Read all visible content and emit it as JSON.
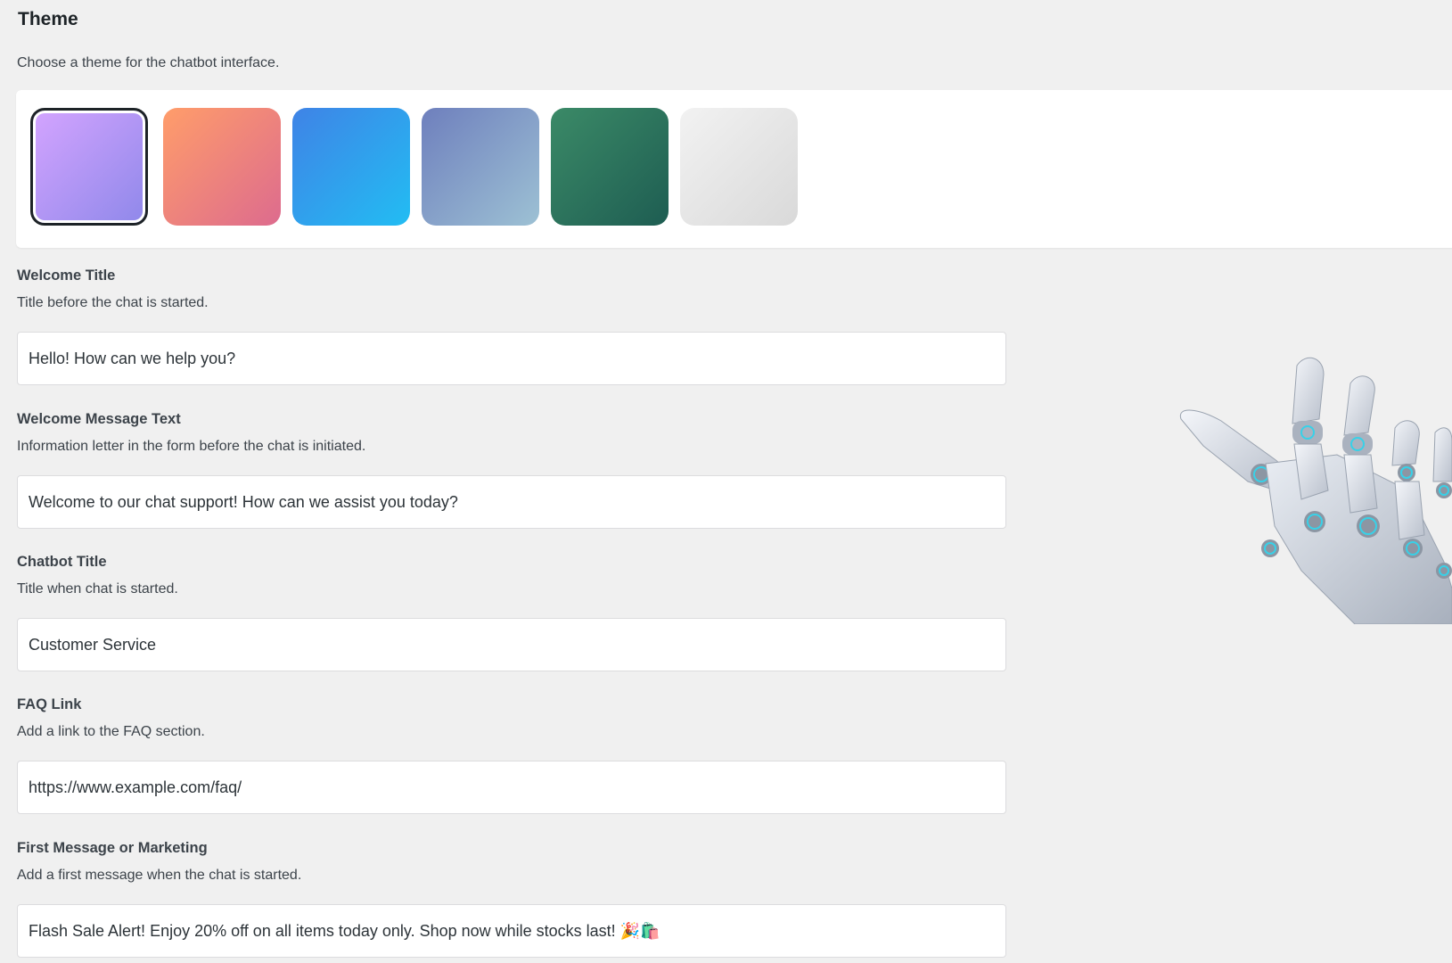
{
  "theme": {
    "heading": "Theme",
    "description": "Choose a theme for the chatbot interface.",
    "swatches": [
      {
        "name": "purple",
        "from": "#d4a4ff",
        "to": "#8f88ea",
        "selected": true
      },
      {
        "name": "sunset",
        "from": "#ff9d6a",
        "to": "#dd6b8e",
        "selected": false
      },
      {
        "name": "blue",
        "from": "#3f83e6",
        "to": "#22bdf3",
        "selected": false
      },
      {
        "name": "steel",
        "from": "#6e7fbd",
        "to": "#9dc1d4",
        "selected": false
      },
      {
        "name": "green",
        "from": "#3b8a67",
        "to": "#1e5d52",
        "selected": false
      },
      {
        "name": "light-gray",
        "from": "#f2f2f2",
        "to": "#d9d9d9",
        "selected": false
      }
    ]
  },
  "fields": {
    "welcome_title": {
      "label": "Welcome Title",
      "help": "Title before the chat is started.",
      "value": "Hello! How can we help you?"
    },
    "welcome_message": {
      "label": "Welcome Message Text",
      "help": "Information letter in the form before the chat is initiated.",
      "value": "Welcome to our chat support! How can we assist you today?"
    },
    "chatbot_title": {
      "label": "Chatbot Title",
      "help": "Title when chat is started.",
      "value": "Customer Service"
    },
    "faq_link": {
      "label": "FAQ Link",
      "help": "Add a link to the FAQ section.",
      "value": "https://www.example.com/faq/"
    },
    "first_message": {
      "label": "First Message or Marketing",
      "help": "Add a first message when the chat is started.",
      "value": "Flash Sale Alert! Enjoy 20% off on all items today only. Shop now while stocks last! 🎉🛍️"
    }
  },
  "illustration": {
    "icon": "robot-hand-icon"
  }
}
